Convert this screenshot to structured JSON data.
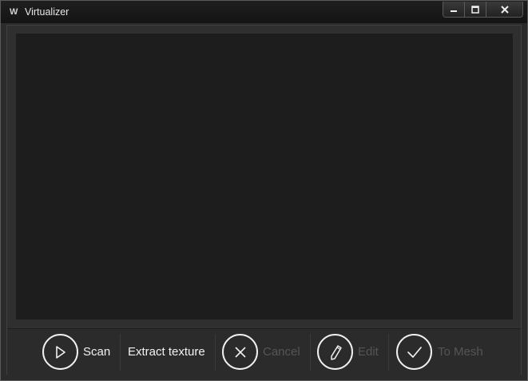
{
  "window": {
    "title": "Virtualizer",
    "app_icon_text": "W",
    "controls": [
      "minimize",
      "maximize",
      "close"
    ]
  },
  "toolbar": {
    "scan_label": "Scan",
    "extract_label": "Extract texture",
    "cancel_label": "Cancel",
    "edit_label": "Edit",
    "to_mesh_label": "To Mesh"
  },
  "colors": {
    "background": "#2b2b2b",
    "viewport": "#1d1d1d",
    "enabled_text": "#f2f2f2",
    "disabled_text": "#555555"
  }
}
